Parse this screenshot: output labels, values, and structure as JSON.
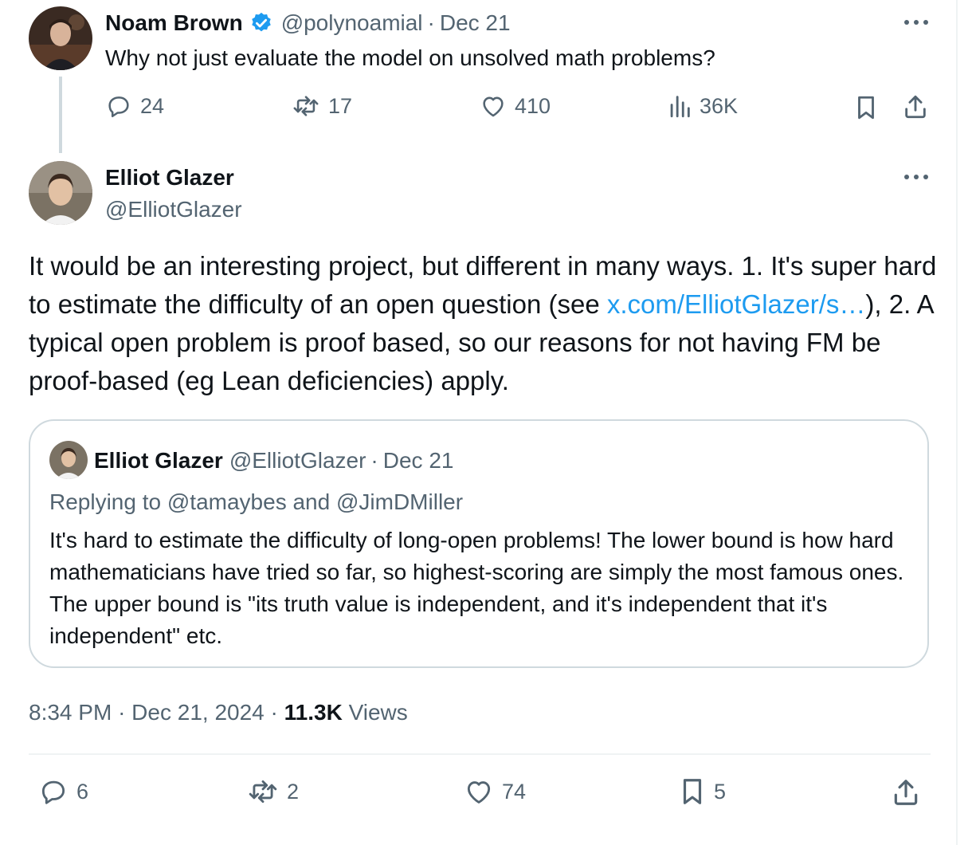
{
  "parent_tweet": {
    "author_name": "Noam Brown",
    "handle": "@polynoamial",
    "separator": "·",
    "date": "Dec 21",
    "text": "Why not just evaluate the model on unsolved math problems?",
    "stats": {
      "replies": "24",
      "reposts": "17",
      "likes": "410",
      "views": "36K"
    },
    "icons": [
      "verified-badge-icon",
      "more-icon",
      "reply-icon",
      "repost-icon",
      "like-icon",
      "views-icon",
      "bookmark-icon",
      "share-icon"
    ]
  },
  "main_tweet": {
    "author_name": "Elliot Glazer",
    "handle": "@ElliotGlazer",
    "text_before_link": "It would be an interesting project, but different in many ways. 1. It's super hard to estimate the difficulty of an open question (see ",
    "link_text": "x.com/ElliotGlazer/s…",
    "text_after_link": "), 2. A typical open problem is proof based, so our reasons for not having FM be proof-based (eg Lean deficiencies) apply.",
    "time": "8:34 PM",
    "sep": "·",
    "date": "Dec 21, 2024",
    "views_count": "11.3K",
    "views_label": "Views",
    "stats": {
      "replies": "6",
      "reposts": "2",
      "likes": "74",
      "bookmarks": "5"
    }
  },
  "quoted_tweet": {
    "author_name": "Elliot Glazer",
    "handle": "@ElliotGlazer",
    "separator": "·",
    "date": "Dec 21",
    "replying_prefix": "Replying to",
    "reply_user1": "@tamaybes",
    "reply_and": "and",
    "reply_user2": "@JimDMiller",
    "text": "It's hard to estimate the difficulty of long-open problems! The lower bound is how hard mathematicians have tried so far, so highest-scoring are simply the most famous ones. The upper bound is \"its truth value is independent, and it's independent that it's independent\" etc."
  },
  "colors": {
    "text": "#0f1419",
    "muted": "#536471",
    "link": "#1d9bf0",
    "border": "#cfd9de",
    "divider": "#eff3f4"
  }
}
